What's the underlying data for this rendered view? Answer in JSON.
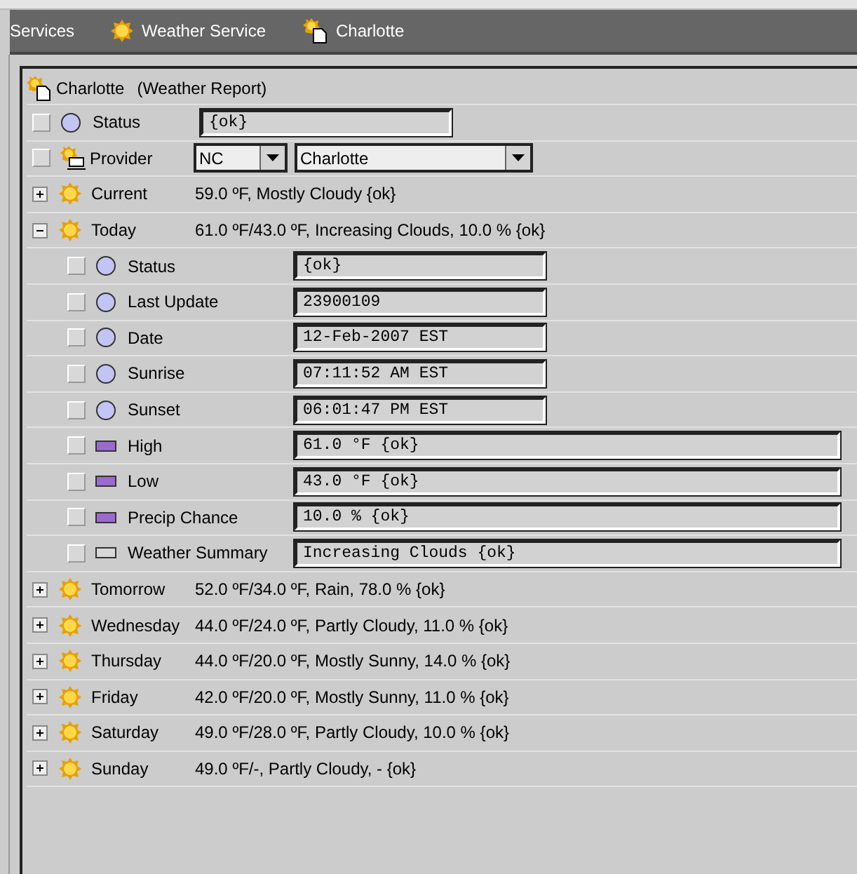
{
  "breadcrumb": [
    {
      "label": "Services",
      "kind": "plain"
    },
    {
      "label": "Weather Service",
      "kind": "sun"
    },
    {
      "label": "Charlotte",
      "kind": "report"
    }
  ],
  "report": {
    "title": "Charlotte",
    "type": "(Weather Report)"
  },
  "rows": [
    {
      "kind": "text-slot",
      "label": "Status",
      "checked": false,
      "value": "{ok}"
    },
    {
      "kind": "select-slot",
      "label": "Provider",
      "checked": false,
      "state": "NC",
      "city": "Charlotte"
    },
    {
      "kind": "group",
      "label": "Current",
      "expanded": false,
      "summary": "59.0 ºF, Mostly Cloudy {ok}"
    },
    {
      "kind": "group",
      "label": "Today",
      "expanded": true,
      "summary": "61.0 ºF/43.0 ºF, Increasing Clouds, 10.0 % {ok}",
      "children": [
        {
          "kind": "text-slot",
          "label": "Status",
          "checked": false,
          "value": "{ok}"
        },
        {
          "kind": "text-slot",
          "label": "Last Update",
          "checked": false,
          "value": "23900109"
        },
        {
          "kind": "text-slot",
          "label": "Date",
          "checked": false,
          "value": "12-Feb-2007 EST"
        },
        {
          "kind": "text-slot",
          "label": "Sunrise",
          "checked": false,
          "value": "07:11:52 AM EST"
        },
        {
          "kind": "text-slot",
          "label": "Sunset",
          "checked": false,
          "value": "06:01:47 PM EST"
        },
        {
          "kind": "number-slot",
          "label": "High",
          "checked": false,
          "value": "61.0 °F {ok}"
        },
        {
          "kind": "number-slot",
          "label": "Low",
          "checked": false,
          "value": "43.0 °F {ok}"
        },
        {
          "kind": "number-slot",
          "label": "Precip Chance",
          "checked": false,
          "value": "10.0 % {ok}"
        },
        {
          "kind": "string-slot",
          "label": "Weather Summary",
          "checked": false,
          "value": "Increasing Clouds {ok}"
        }
      ]
    },
    {
      "kind": "group",
      "label": "Tomorrow",
      "expanded": false,
      "summary": "52.0 ºF/34.0 ºF, Rain, 78.0 % {ok}"
    },
    {
      "kind": "group",
      "label": "Wednesday",
      "expanded": false,
      "summary": "44.0 ºF/24.0 ºF, Partly Cloudy, 11.0 % {ok}"
    },
    {
      "kind": "group",
      "label": "Thursday",
      "expanded": false,
      "summary": "44.0 ºF/20.0 ºF, Mostly Sunny, 14.0 % {ok}"
    },
    {
      "kind": "group",
      "label": "Friday",
      "expanded": false,
      "summary": "42.0 ºF/20.0 ºF, Mostly Sunny, 11.0 % {ok}"
    },
    {
      "kind": "group",
      "label": "Saturday",
      "expanded": false,
      "summary": "49.0 ºF/28.0 ºF, Partly Cloudy, 10.0 % {ok}"
    },
    {
      "kind": "group",
      "label": "Sunday",
      "expanded": false,
      "summary": "49.0 ºF/-, Partly Cloudy, - {ok}"
    }
  ]
}
